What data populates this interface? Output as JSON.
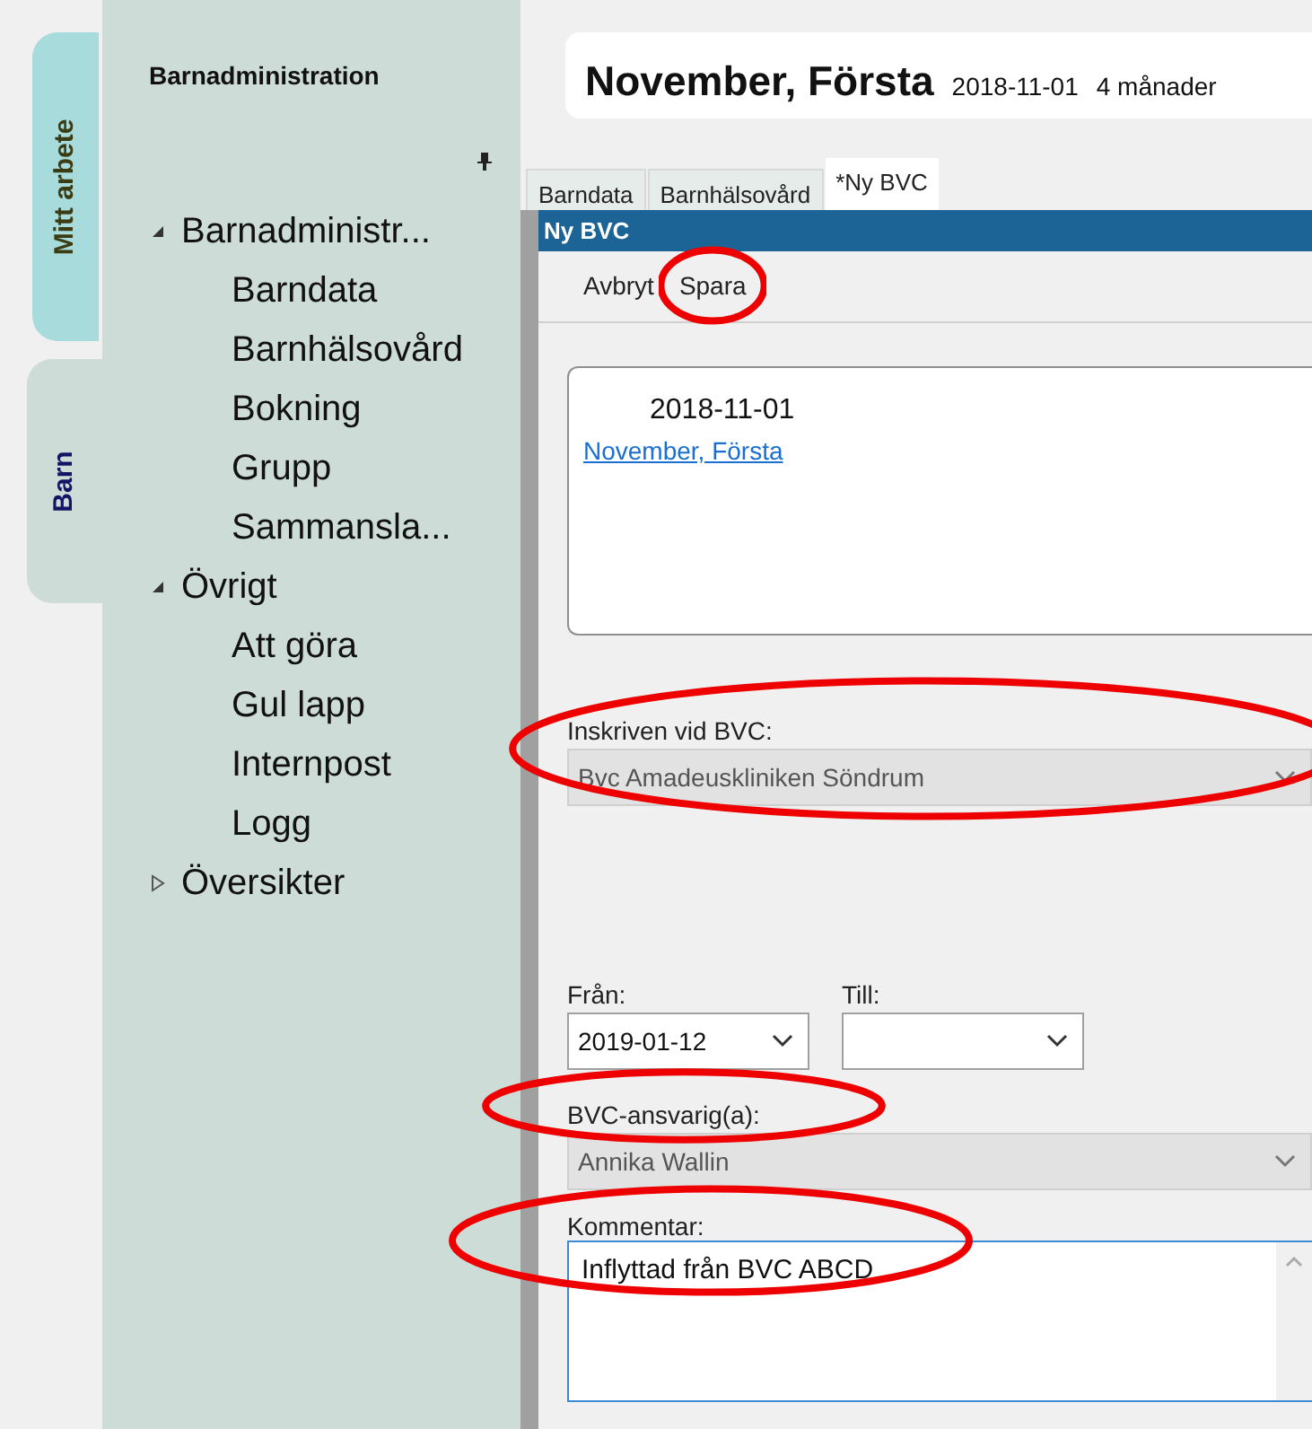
{
  "side_tabs": [
    {
      "label": "Mitt arbete",
      "selected": false
    },
    {
      "label": "Barn",
      "selected": true
    }
  ],
  "sidebar": {
    "title": "Barnadministration",
    "items": [
      {
        "label": "Barnadministr...",
        "expanded": true,
        "children": [
          {
            "label": "Barndata"
          },
          {
            "label": "Barnhälsovård"
          },
          {
            "label": "Bokning"
          },
          {
            "label": "Grupp"
          },
          {
            "label": "Sammansla..."
          }
        ]
      },
      {
        "label": "Övrigt",
        "expanded": true,
        "children": [
          {
            "label": "Att göra"
          },
          {
            "label": "Gul lapp"
          },
          {
            "label": "Internpost"
          },
          {
            "label": "Logg"
          }
        ]
      },
      {
        "label": "Översikter",
        "expanded": false
      }
    ]
  },
  "patient": {
    "name": "November, Första",
    "birth_date": "2018-11-01",
    "age": "4 månader"
  },
  "tabs": [
    {
      "label": "Barndata",
      "selected": false
    },
    {
      "label": "Barnhälsovård",
      "selected": false
    },
    {
      "label": "*Ny BVC",
      "selected": true
    }
  ],
  "panel": {
    "title": "Ny BVC",
    "toolbar": [
      {
        "label": "Avbryt",
        "circled": false
      },
      {
        "label": "Spara",
        "circled": true
      }
    ],
    "card": {
      "date": "2018-11-01",
      "link": "November, Första"
    },
    "clinic": {
      "label": "Inskriven vid BVC:",
      "value": "Bvc Amadeuskliniken Söndrum",
      "disabled": true,
      "circled": true
    },
    "from": {
      "label": "Från:",
      "value": "2019-01-12",
      "disabled": false
    },
    "to": {
      "label": "Till:",
      "disabled": false
    },
    "responsible": {
      "label": "BVC-ansvarig(a):",
      "value": "Annika Wallin",
      "disabled": true,
      "circled": true
    },
    "comment": {
      "label": "Kommentar:",
      "value": "Inflyttad från BVC ABCD",
      "circled": true
    }
  }
}
